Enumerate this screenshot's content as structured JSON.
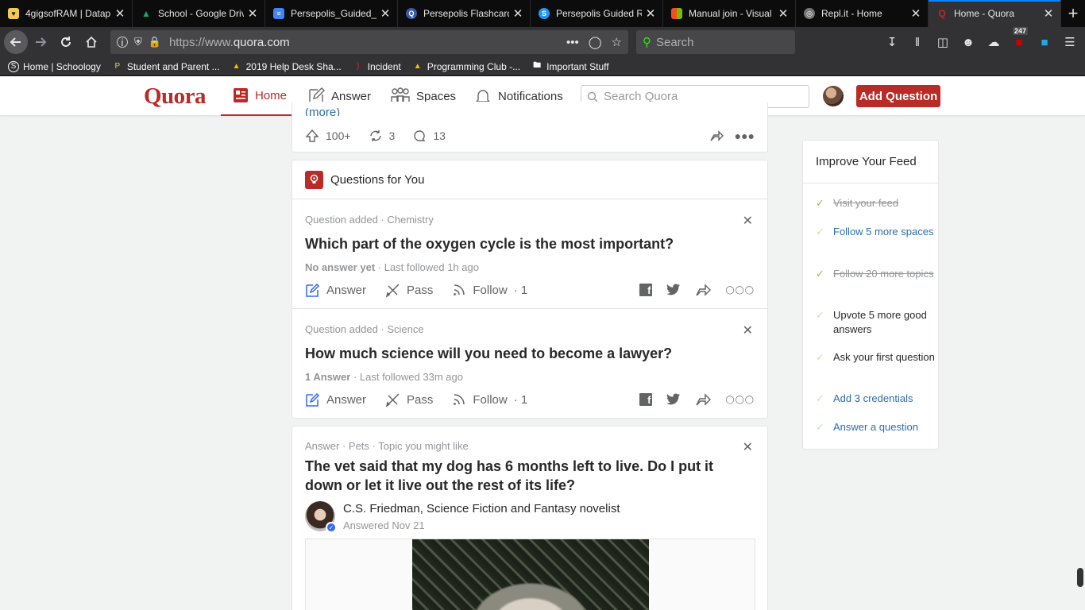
{
  "browser": {
    "tabs": [
      {
        "label": "4gigsofRAM | Datap",
        "fav_color": "#f2c94c",
        "fav_char": "♥"
      },
      {
        "label": "School - Google Driv",
        "fav_color": "#1fa463",
        "fav_char": "▲"
      },
      {
        "label": "Persepolis_Guided_R",
        "fav_color": "#4285f4",
        "fav_char": "≡"
      },
      {
        "label": "Persepolis Flashcard",
        "fav_color": "#3d59ab",
        "fav_char": "Q"
      },
      {
        "label": "Persepolis Guided R",
        "fav_color": "#2196f3",
        "fav_char": "S"
      },
      {
        "label": "Manual join - Visual",
        "fav_color": "#f25022",
        "fav_char": "■"
      },
      {
        "label": "Repl.it - Home",
        "fav_color": "#777777",
        "fav_char": "◎"
      },
      {
        "label": "Home - Quora",
        "fav_color": "#b92b27",
        "fav_char": "Q"
      }
    ],
    "url_prefix": "https://www.",
    "url_domain": "quora.com",
    "search_placeholder": "Search",
    "badge_count": "247",
    "bookmarks": [
      {
        "label": "Home | Schoology",
        "icon": "S"
      },
      {
        "label": "Student and Parent ...",
        "icon": "P"
      },
      {
        "label": "2019 Help Desk Sha...",
        "icon": "▲"
      },
      {
        "label": "Incident",
        "icon": ")"
      },
      {
        "label": "Programming Club -...",
        "icon": "▲"
      },
      {
        "label": "Important Stuff",
        "icon": "□"
      }
    ]
  },
  "quora": {
    "logo": "Quora",
    "nav": {
      "home": "Home",
      "answer": "Answer",
      "spaces": "Spaces",
      "notifications": "Notifications"
    },
    "search_placeholder": "Search Quora",
    "add_question": "Add Question",
    "brand_color": "#b92b27"
  },
  "feed": {
    "prev_card": {
      "more_link": "(more)",
      "upvotes": "100+",
      "shares": "3",
      "comments": "13"
    },
    "qfy": {
      "title": "Questions for You",
      "items": [
        {
          "meta": "Question added · Chemistry",
          "question": "Which part of the oxygen cycle is the most important?",
          "status_bold": "No answer yet",
          "status_rest": " · Last followed 1h ago",
          "answer": "Answer",
          "pass": "Pass",
          "follow": "Follow",
          "follow_count": "· 1"
        },
        {
          "meta": "Question added · Science",
          "question": "How much science will you need to become a lawyer?",
          "status_bold": "1 Answer",
          "status_rest": " · Last followed 33m ago",
          "answer": "Answer",
          "pass": "Pass",
          "follow": "Follow",
          "follow_count": "· 1"
        }
      ]
    },
    "answer_card": {
      "meta": "Answer · Pets · Topic you might like",
      "question": "The vet said that my dog has 6 months left to live. Do I put it down or let it live out the rest of its life?",
      "author": "C.S. Friedman, Science Fiction and Fantasy novelist",
      "date": "Answered Nov 21"
    }
  },
  "sidebar": {
    "title": "Improve Your Feed",
    "items": [
      {
        "label": "Visit your feed",
        "state": "done"
      },
      {
        "label": "Follow 5 more spaces",
        "state": "link"
      },
      {
        "label": "Follow 20 more topics",
        "state": "done"
      },
      {
        "label": "Upvote 5 more good answers",
        "state": "plain"
      },
      {
        "label": "Ask your first question",
        "state": "plain"
      },
      {
        "label": "Add 3 credentials",
        "state": "link"
      },
      {
        "label": "Answer a question",
        "state": "link"
      }
    ]
  }
}
